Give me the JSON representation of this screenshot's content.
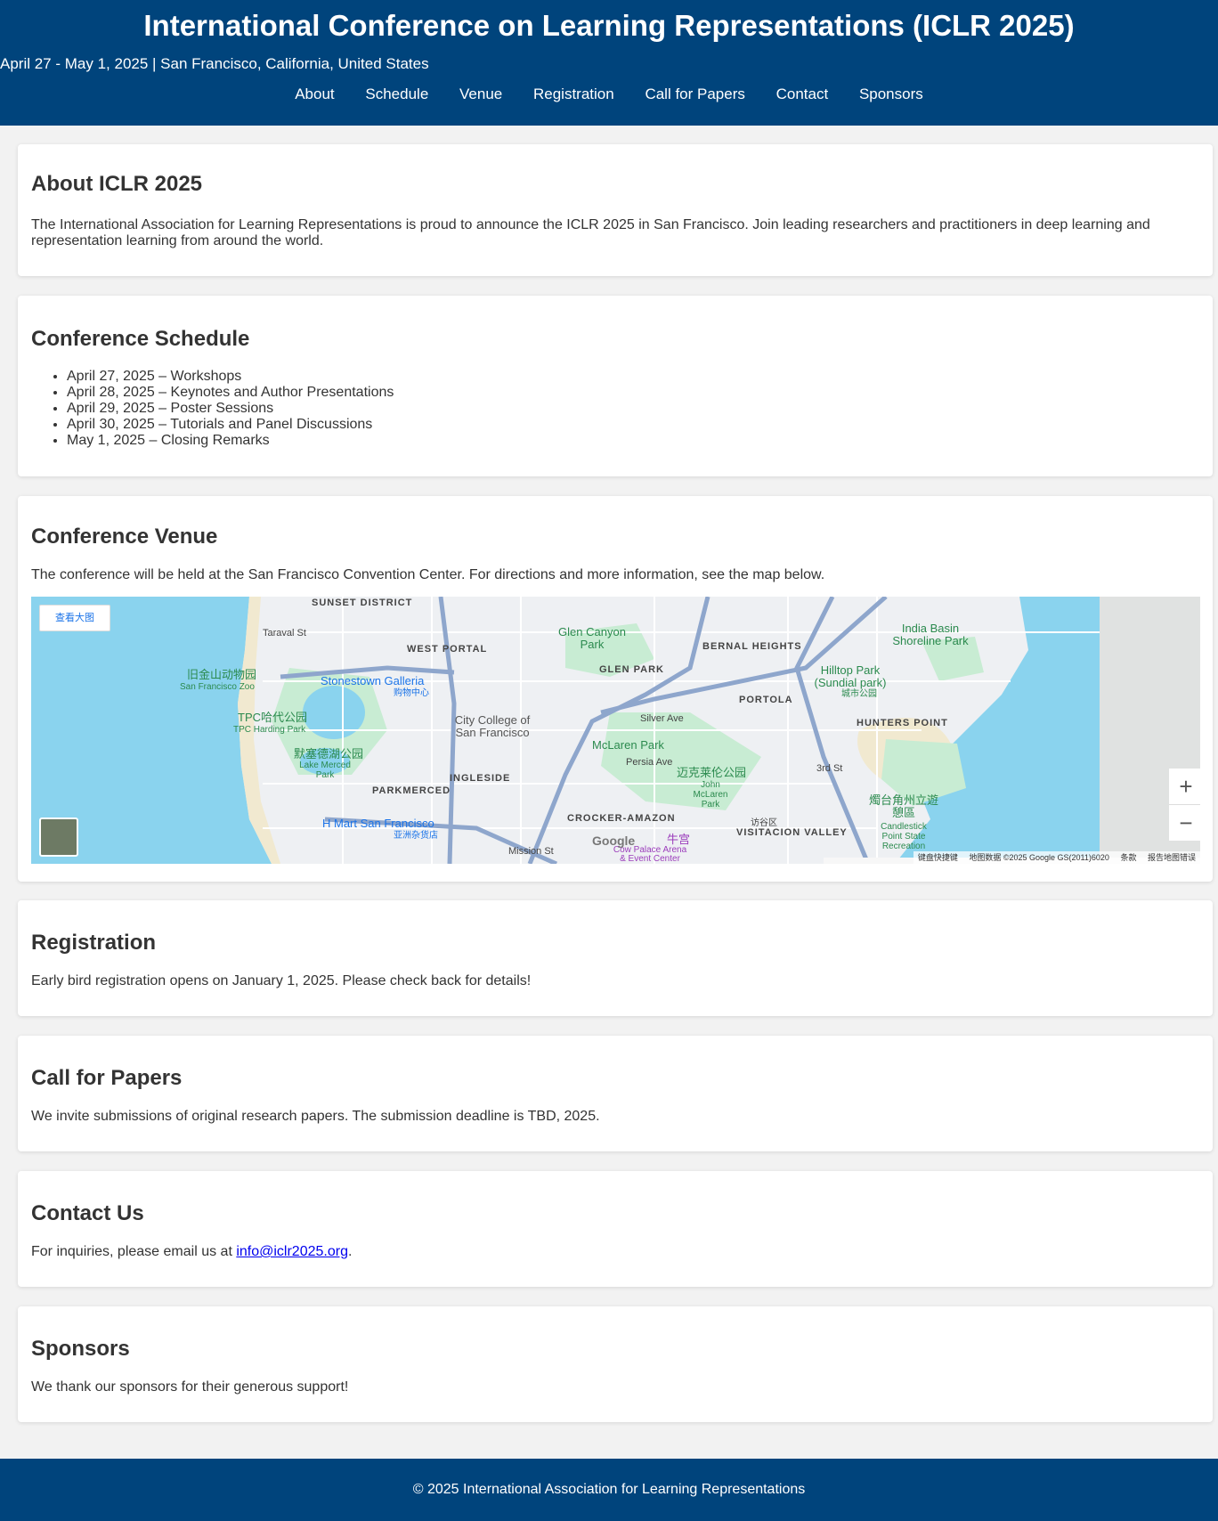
{
  "header": {
    "title": "International Conference on Learning Representations (ICLR 2025)",
    "subtitle": "April 27 - May 1, 2025 | San Francisco, California, United States",
    "nav": [
      "About",
      "Schedule",
      "Venue",
      "Registration",
      "Call for Papers",
      "Contact",
      "Sponsors"
    ]
  },
  "about": {
    "heading": "About ICLR 2025",
    "text": "The International Association for Learning Representations is proud to announce the ICLR 2025 in San Francisco. Join leading researchers and practitioners in deep learning and representation learning from around the world."
  },
  "schedule": {
    "heading": "Conference Schedule",
    "items": [
      "April 27, 2025 – Workshops",
      "April 28, 2025 – Keynotes and Author Presentations",
      "April 29, 2025 – Poster Sessions",
      "April 30, 2025 – Tutorials and Panel Discussions",
      "May 1, 2025 – Closing Remarks"
    ]
  },
  "venue": {
    "heading": "Conference Venue",
    "text": "The conference will be held at the San Francisco Convention Center. For directions and more information, see the map below.",
    "map": {
      "view_larger": "查看大图",
      "districts": [
        "SUNSET DISTRICT",
        "WEST PORTAL",
        "GLEN PARK",
        "BERNAL HEIGHTS",
        "PORTOLA",
        "HUNTERS POINT",
        "INGLESIDE",
        "PARKMERCED",
        "CROCKER-AMAZON",
        "VISITACION VALLEY"
      ],
      "streets": [
        "Taraval St",
        "Silver Ave",
        "Persia Ave",
        "Mission St",
        "3rd St"
      ],
      "parks": [
        "Glen Canyon Park",
        "McLaren Park",
        "India Basin Shoreline Park",
        "Hilltop Park (Sundial park)",
        "迈克莱伦公园",
        "John McLaren Park",
        "Lake Merced Park",
        "默塞德湖公园",
        "燭台角州立遊憩區",
        "Candlestick Point State Recreation",
        "城市公园",
        "TPC哈代公园",
        "TPC Harding Park"
      ],
      "pois": [
        "旧金山动物园",
        "San Francisco Zoo",
        "Stonestown Galleria",
        "购物中心",
        "City College of San Francisco",
        "H Mart San Francisco",
        "亚洲杂货店",
        "牛宫",
        "Cow Palace Arena & Event Center",
        "访谷区"
      ],
      "footer": [
        "键盘快捷键",
        "地图数据 ©2025 Google GS(2011)6020",
        "条款",
        "报告地图错误"
      ],
      "zoom_in": "+",
      "zoom_out": "−",
      "logo": "Google"
    }
  },
  "registration": {
    "heading": "Registration",
    "text": "Early bird registration opens on January 1, 2025. Please check back for details!"
  },
  "papers": {
    "heading": "Call for Papers",
    "text": "We invite submissions of original research papers. The submission deadline is TBD, 2025."
  },
  "contact": {
    "heading": "Contact Us",
    "text_before": "For inquiries, please email us at ",
    "email": "info@iclr2025.org",
    "text_after": "."
  },
  "sponsors": {
    "heading": "Sponsors",
    "text": "We thank our sponsors for their generous support!"
  },
  "footer": {
    "text": "© 2025 International Association for Learning Representations"
  }
}
